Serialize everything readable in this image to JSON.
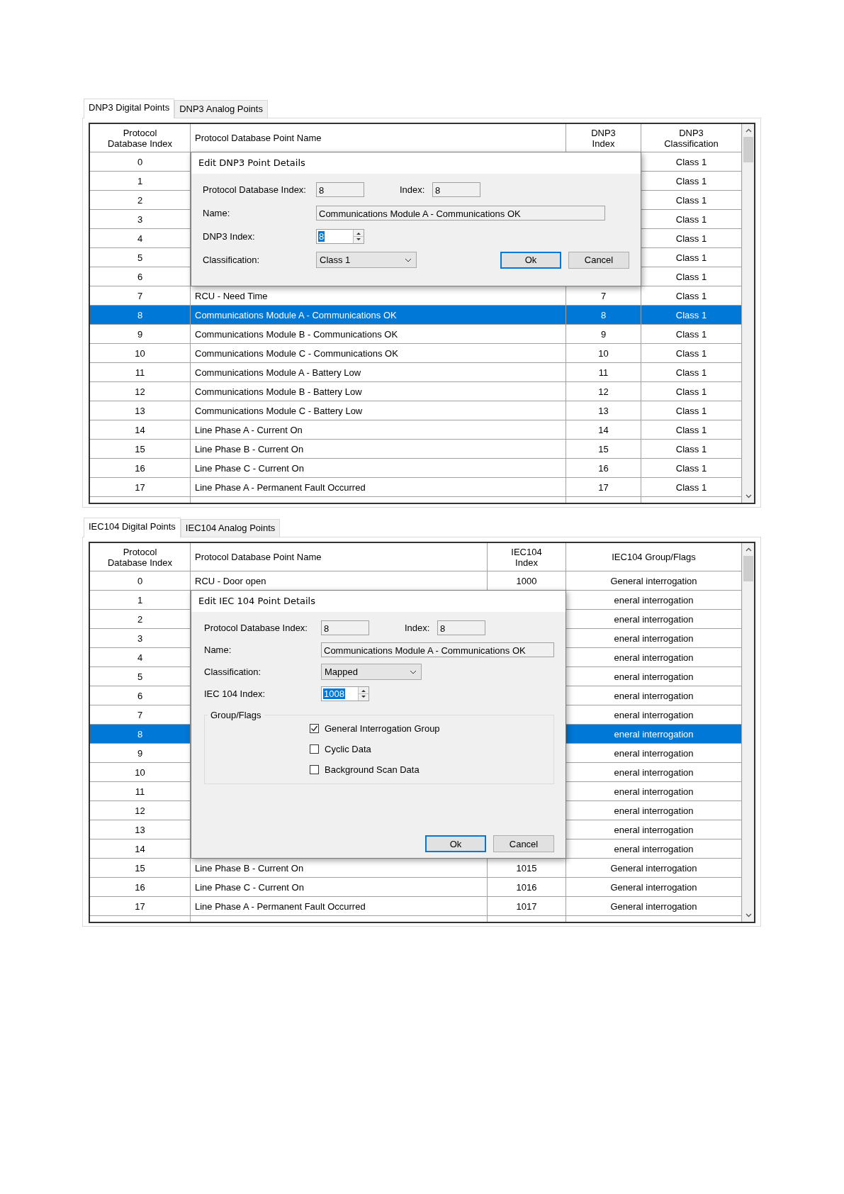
{
  "panels": [
    {
      "tabs": [
        {
          "label": "DNP3 Digital Points",
          "selected": true
        },
        {
          "label": "DNP3 Analog Points",
          "selected": false
        }
      ],
      "columns": [
        "Protocol Database Index",
        "Protocol Database Point Name",
        "DNP3 Index",
        "DNP3 Classification"
      ],
      "rows": [
        {
          "cells": [
            "0",
            null,
            null,
            "Class 1"
          ],
          "selected": false
        },
        {
          "cells": [
            "1",
            null,
            null,
            "Class 1"
          ],
          "selected": false
        },
        {
          "cells": [
            "2",
            null,
            null,
            "Class 1"
          ],
          "selected": false
        },
        {
          "cells": [
            "3",
            null,
            null,
            "Class 1"
          ],
          "selected": false
        },
        {
          "cells": [
            "4",
            null,
            null,
            "Class 1"
          ],
          "selected": false
        },
        {
          "cells": [
            "5",
            null,
            null,
            "Class 1"
          ],
          "selected": false
        },
        {
          "cells": [
            "6",
            null,
            null,
            "Class 1"
          ],
          "selected": false
        },
        {
          "cells": [
            "7",
            "RCU - Need Time",
            "7",
            "Class 1"
          ],
          "selected": false
        },
        {
          "cells": [
            "8",
            "Communications Module A - Communications OK",
            "8",
            "Class 1"
          ],
          "selected": true
        },
        {
          "cells": [
            "9",
            "Communications Module B - Communications OK",
            "9",
            "Class 1"
          ],
          "selected": false
        },
        {
          "cells": [
            "10",
            "Communications Module C - Communications OK",
            "10",
            "Class 1"
          ],
          "selected": false
        },
        {
          "cells": [
            "11",
            "Communications Module A - Battery Low",
            "11",
            "Class 1"
          ],
          "selected": false
        },
        {
          "cells": [
            "12",
            "Communications Module B - Battery Low",
            "12",
            "Class 1"
          ],
          "selected": false
        },
        {
          "cells": [
            "13",
            "Communications Module C - Battery Low",
            "13",
            "Class 1"
          ],
          "selected": false
        },
        {
          "cells": [
            "14",
            "Line Phase A - Current On",
            "14",
            "Class 1"
          ],
          "selected": false
        },
        {
          "cells": [
            "15",
            "Line Phase B - Current On",
            "15",
            "Class 1"
          ],
          "selected": false
        },
        {
          "cells": [
            "16",
            "Line Phase C - Current On",
            "16",
            "Class 1"
          ],
          "selected": false
        },
        {
          "cells": [
            "17",
            "Line Phase A - Permanent Fault Occurred",
            "17",
            "Class 1"
          ],
          "selected": false
        }
      ],
      "dialog": {
        "title": "Edit DNP3 Point Details",
        "fields": [
          {
            "kind": "pair",
            "label": "Protocol Database Index:",
            "value": "8",
            "label2": "Index:",
            "value2": "8"
          },
          {
            "kind": "text",
            "label": "Name:",
            "value": "Communications Module A - Communications OK"
          },
          {
            "kind": "spin",
            "label": "DNP3 Index:",
            "value": "8",
            "selected_text": true
          },
          {
            "kind": "select",
            "label": "Classification:",
            "value": "Class 1"
          }
        ],
        "buttons": [
          {
            "label": "Ok",
            "focused": true
          },
          {
            "label": "Cancel",
            "focused": false
          }
        ]
      }
    },
    {
      "tabs": [
        {
          "label": "IEC104 Digital Points",
          "selected": true
        },
        {
          "label": "IEC104 Analog Points",
          "selected": false
        }
      ],
      "columns": [
        "Protocol Database Index",
        "Protocol Database Point Name",
        "IEC104 Index",
        "IEC104 Group/Flags"
      ],
      "rows": [
        {
          "cells": [
            "0",
            "RCU - Door open",
            "1000",
            "General interrogation"
          ],
          "selected": false
        },
        {
          "cells": [
            "1",
            null,
            null,
            "eneral interrogation"
          ],
          "selected": false
        },
        {
          "cells": [
            "2",
            null,
            null,
            "eneral interrogation"
          ],
          "selected": false
        },
        {
          "cells": [
            "3",
            null,
            null,
            "eneral interrogation"
          ],
          "selected": false
        },
        {
          "cells": [
            "4",
            null,
            null,
            "eneral interrogation"
          ],
          "selected": false
        },
        {
          "cells": [
            "5",
            null,
            null,
            "eneral interrogation"
          ],
          "selected": false
        },
        {
          "cells": [
            "6",
            null,
            null,
            "eneral interrogation"
          ],
          "selected": false
        },
        {
          "cells": [
            "7",
            null,
            null,
            "eneral interrogation"
          ],
          "selected": false
        },
        {
          "cells": [
            "8",
            null,
            null,
            "eneral interrogation"
          ],
          "selected": true
        },
        {
          "cells": [
            "9",
            null,
            null,
            "eneral interrogation"
          ],
          "selected": false
        },
        {
          "cells": [
            "10",
            null,
            null,
            "eneral interrogation"
          ],
          "selected": false
        },
        {
          "cells": [
            "11",
            null,
            null,
            "eneral interrogation"
          ],
          "selected": false
        },
        {
          "cells": [
            "12",
            null,
            null,
            "eneral interrogation"
          ],
          "selected": false
        },
        {
          "cells": [
            "13",
            null,
            null,
            "eneral interrogation"
          ],
          "selected": false
        },
        {
          "cells": [
            "14",
            null,
            null,
            "eneral interrogation"
          ],
          "selected": false
        },
        {
          "cells": [
            "15",
            "Line Phase B - Current On",
            "1015",
            "General interrogation"
          ],
          "selected": false
        },
        {
          "cells": [
            "16",
            "Line Phase C - Current On",
            "1016",
            "General interrogation"
          ],
          "selected": false
        },
        {
          "cells": [
            "17",
            "Line Phase A - Permanent Fault Occurred",
            "1017",
            "General interrogation"
          ],
          "selected": false
        }
      ],
      "dialog": {
        "title": "Edit IEC 104 Point Details",
        "fields": [
          {
            "kind": "pair",
            "label": "Protocol Database Index:",
            "value": "8",
            "label2": "Index:",
            "value2": "8"
          },
          {
            "kind": "text",
            "label": "Name:",
            "value": "Communications Module A - Communications OK"
          },
          {
            "kind": "select",
            "label": "Classification:",
            "value": "Mapped"
          },
          {
            "kind": "spin",
            "label": "IEC 104 Index:",
            "value": "1008",
            "selected_text": true
          }
        ],
        "group": {
          "title": "Group/Flags",
          "checkboxes": [
            {
              "label": "General Interrogation Group",
              "checked": true
            },
            {
              "label": "Cyclic Data",
              "checked": false
            },
            {
              "label": "Background Scan Data",
              "checked": false
            }
          ]
        },
        "buttons": [
          {
            "label": "Ok",
            "focused": true
          },
          {
            "label": "Cancel",
            "focused": false
          }
        ]
      }
    }
  ]
}
